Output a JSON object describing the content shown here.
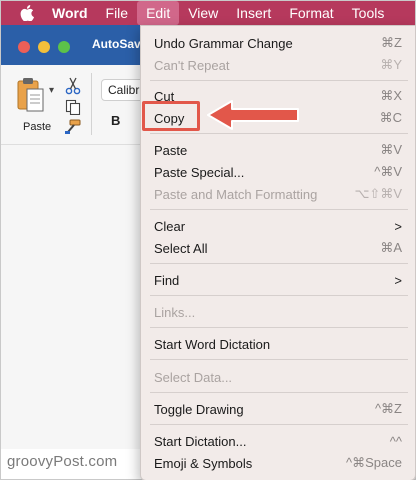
{
  "menubar": {
    "app": "Word",
    "items": [
      "File",
      "Edit",
      "View",
      "Insert",
      "Format",
      "Tools"
    ]
  },
  "window": {
    "title": "AutoSave",
    "ribbon": {
      "paste_label": "Paste",
      "font_name": "Calibri",
      "bold_label": "B"
    }
  },
  "edit_menu": {
    "items": [
      {
        "label": "Undo Grammar Change",
        "shortcut": "⌘Z",
        "enabled": true
      },
      {
        "label": "Can't Repeat",
        "shortcut": "⌘Y",
        "enabled": false
      },
      {
        "label": "Cut",
        "shortcut": "⌘X",
        "enabled": true
      },
      {
        "label": "Copy",
        "shortcut": "⌘C",
        "enabled": true
      },
      {
        "label": "Paste",
        "shortcut": "⌘V",
        "enabled": true
      },
      {
        "label": "Paste Special...",
        "shortcut": "^⌘V",
        "enabled": true
      },
      {
        "label": "Paste and Match Formatting",
        "shortcut": "⌥⇧⌘V",
        "enabled": false
      },
      {
        "label": "Clear",
        "shortcut": ">",
        "enabled": true
      },
      {
        "label": "Select All",
        "shortcut": "⌘A",
        "enabled": true
      },
      {
        "label": "Find",
        "shortcut": ">",
        "enabled": true
      },
      {
        "label": "Links...",
        "shortcut": "",
        "enabled": false
      },
      {
        "label": "Start Word Dictation",
        "shortcut": "",
        "enabled": true
      },
      {
        "label": "Select Data...",
        "shortcut": "",
        "enabled": false
      },
      {
        "label": "Toggle Drawing",
        "shortcut": "^⌘Z",
        "enabled": true
      },
      {
        "label": "Start Dictation...",
        "shortcut": "^^",
        "enabled": true
      },
      {
        "label": "Emoji & Symbols",
        "shortcut": "^⌘Space",
        "enabled": true
      }
    ]
  },
  "watermark": "groovyPost.com",
  "colors": {
    "menubar": "#b6395d",
    "titlebar": "#2b5fa8",
    "highlight": "#e2574a",
    "menu_bg": "#f2ebe9"
  }
}
